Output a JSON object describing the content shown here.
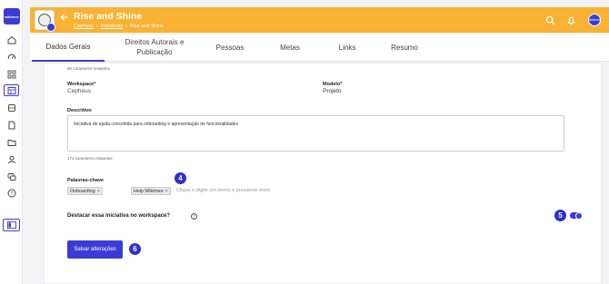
{
  "app": {
    "logo_text": "wikimee"
  },
  "header": {
    "title": "Rise and Shine",
    "breadcrumbs": [
      "Cepheus",
      "Iniciativas",
      "Rise and Shine"
    ],
    "avatar_text": "wikimee",
    "accent_color": "#f9b233"
  },
  "tabs": [
    {
      "label": "Dados Gerais",
      "active": true
    },
    {
      "label": "Direitos Autorais e Publicação",
      "active": false
    },
    {
      "label": "Pessoas",
      "active": false
    },
    {
      "label": "Metas",
      "active": false
    },
    {
      "label": "Links",
      "active": false
    },
    {
      "label": "Resumo",
      "active": false
    }
  ],
  "form": {
    "top_counter": "86 caracteres restantes",
    "workspace_label": "Workspace*",
    "workspace_value": "Cepheus",
    "modelo_label": "Modelo*",
    "modelo_value": "Projeto",
    "descritivo_label": "Descritivo",
    "descritivo_value": "Iniciativa de ajuda concebida para onboarding e apresentação de funcionalidades",
    "descritivo_counter": "171 caracteres restantes",
    "keywords_label": "Palavras-chave",
    "keywords": [
      "Onboarding",
      "Help Wikimee"
    ],
    "keywords_placeholder": "Clique e digite um termo e pressione enter",
    "destacar_label": "Destacar essa iniciativa no workspace?",
    "destacar_enabled": true,
    "save_label": "Salvar alterações"
  },
  "annotations": {
    "step4": "4",
    "step5": "5",
    "step6": "6"
  },
  "colors": {
    "primary": "#3b3bd6",
    "header": "#f9b233"
  }
}
